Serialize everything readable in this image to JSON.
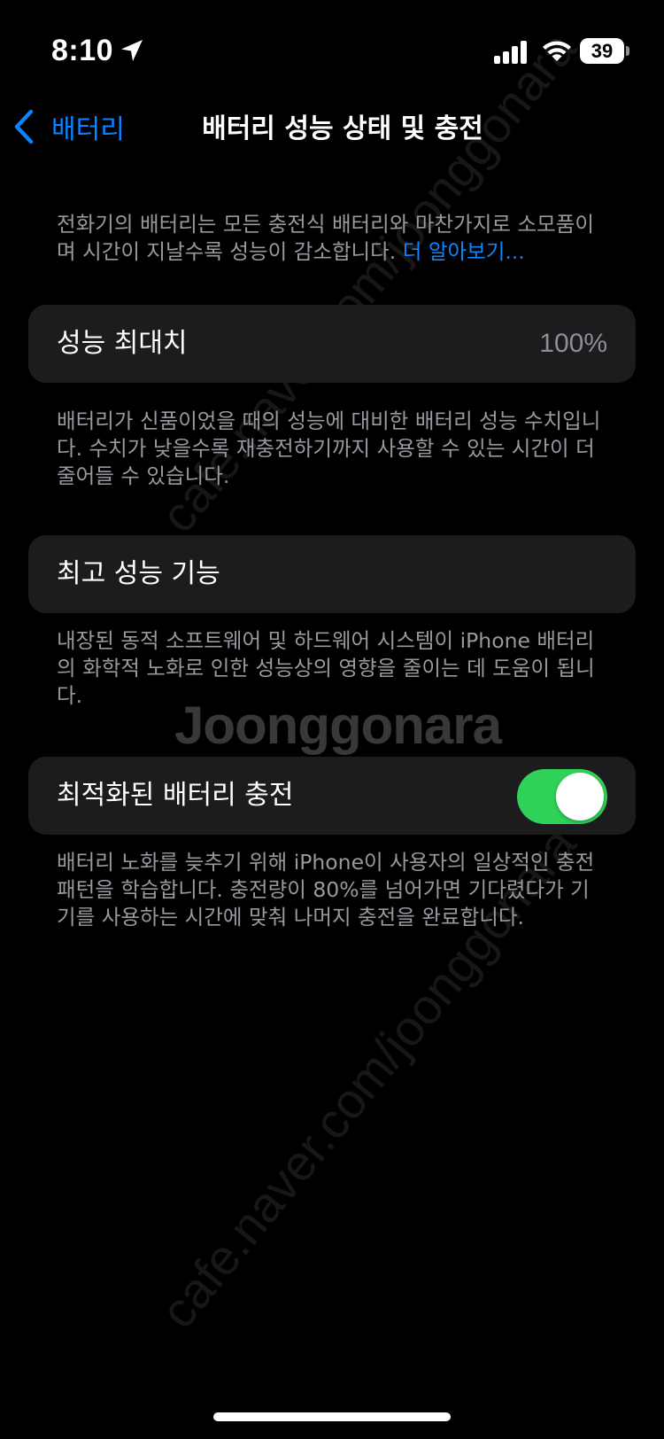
{
  "status_bar": {
    "time": "8:10",
    "battery_level": "39",
    "icons": [
      "location-arrow-icon",
      "cellular-signal-icon",
      "wifi-icon",
      "battery-icon"
    ]
  },
  "nav": {
    "back_label": "배터리",
    "title": "배터리 성능 상태 및 충전",
    "back_icon": "chevron-left-icon"
  },
  "intro": {
    "text": "전화기의 배터리는 모든 충전식 배터리와 마찬가지로 소모품이며 시간이 지날수록 성능이 감소합니다. ",
    "learn_more": "더 알아보기..."
  },
  "max_capacity": {
    "label": "성능 최대치",
    "value": "100%",
    "footer": "배터리가 신품이었을 때의 성능에 대비한 배터리 성능 수치입니다. 수치가 낮을수록 재충전하기까지 사용할 수 있는 시간이 더 줄어들 수 있습니다."
  },
  "peak_performance": {
    "label": "최고 성능 기능",
    "footer": "내장된 동적 소프트웨어 및 하드웨어 시스템이 iPhone 배터리의 화학적 노화로 인한 성능상의 영향을 줄이는 데 도움이 됩니다."
  },
  "optimized_charging": {
    "label": "최적화된 배터리 충전",
    "enabled": true,
    "footer": "배터리 노화를 늦추기 위해 iPhone이 사용자의 일상적인 충전 패턴을 학습합니다. 충전량이 80%를 넘어가면 기다렸다가 기기를 사용하는 시간에 맞춰 나머지 충전을 완료합니다."
  },
  "watermark": {
    "logo": "Joonggonara",
    "url": "cafe.naver.com/joonggonara"
  },
  "colors": {
    "background": "#000000",
    "card": "#1c1c1e",
    "accent": "#0a84ff",
    "toggle_on": "#30d158",
    "secondary_text": "#98989f"
  }
}
